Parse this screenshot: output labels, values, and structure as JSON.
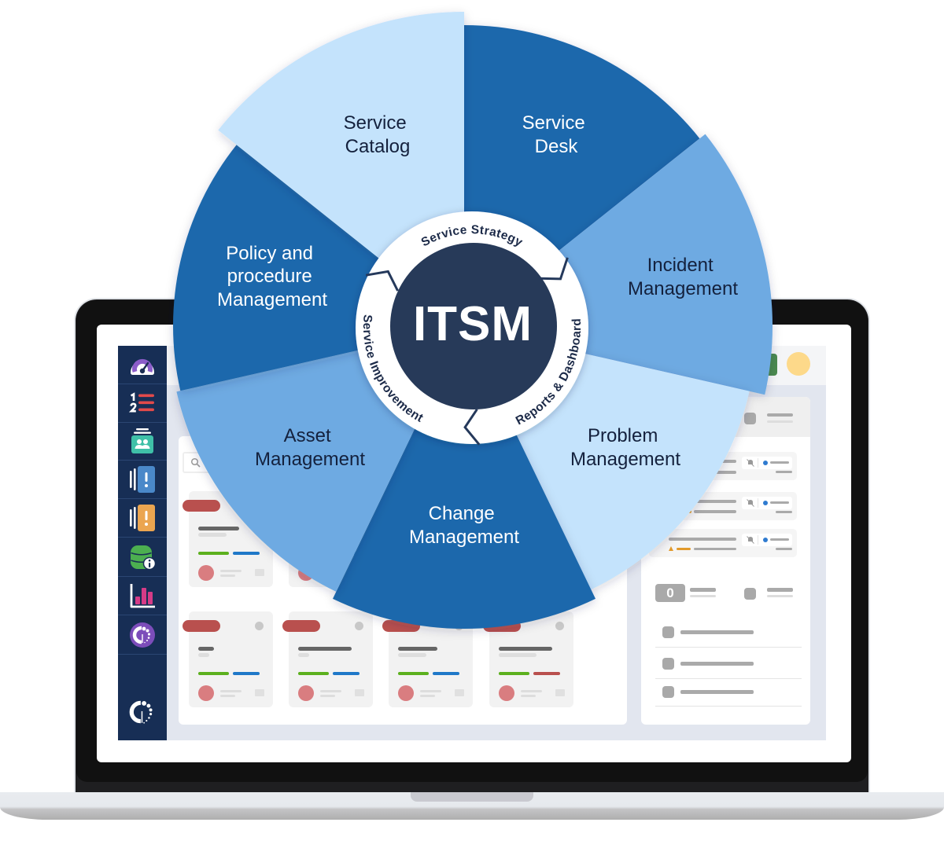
{
  "wheel": {
    "center_label": "ITSM",
    "ring_labels": {
      "top": "Service Strategy",
      "right": "Reports & Dashboard",
      "left": "Service Improvement"
    },
    "segments": [
      {
        "id": "service-desk",
        "lines": [
          "Service",
          "Desk"
        ],
        "color": "#1f68ac",
        "text_color": "#ffffff"
      },
      {
        "id": "incident-management",
        "lines": [
          "Incident",
          "Management"
        ],
        "color": "#6eaae2",
        "text_color": "#14213d"
      },
      {
        "id": "problem-management",
        "lines": [
          "Problem",
          "Management"
        ],
        "color": "#c4e3fc",
        "text_color": "#14213d"
      },
      {
        "id": "change-management",
        "lines": [
          "Change",
          "Management"
        ],
        "color": "#1f68ac",
        "text_color": "#ffffff"
      },
      {
        "id": "asset-management",
        "lines": [
          "Asset",
          "Management"
        ],
        "color": "#6eaae2",
        "text_color": "#14213d"
      },
      {
        "id": "policy-and-procedure-management",
        "lines": [
          "Policy and",
          "procedure",
          "Management"
        ],
        "color": "#1f68ac",
        "text_color": "#ffffff"
      },
      {
        "id": "service-catalog",
        "lines": [
          "Service",
          "Catalog"
        ],
        "color": "#c4e3fc",
        "text_color": "#14213d"
      }
    ],
    "colors": {
      "ring": "#ffffff",
      "core": "#273a59",
      "divider": "#25395b",
      "ring_text": "#1c2a48",
      "center_text": "#ffffff"
    }
  },
  "app": {
    "sidebar": {
      "items": [
        {
          "icon": "dashboard-gauge-icon"
        },
        {
          "icon": "numbered-list-icon"
        },
        {
          "icon": "team-queue-icon"
        },
        {
          "icon": "incident-alert-icon"
        },
        {
          "icon": "problem-alert-icon"
        },
        {
          "icon": "cmdb-database-icon"
        },
        {
          "icon": "reports-bar-chart-icon"
        },
        {
          "icon": "brand-circle-icon"
        }
      ],
      "footer_icon": "brand-logo-icon"
    },
    "header": {
      "avatar_icon": "user-avatar-icon",
      "action_button_color": "#4b8a4f"
    },
    "right_panel": {
      "counter_badge": "0"
    },
    "colors": {
      "sidebar": "#172e55",
      "card_tag_green": "#5cb01e",
      "card_tag_blue": "#1f78c8",
      "card_priority_red": "#b9504e"
    }
  }
}
